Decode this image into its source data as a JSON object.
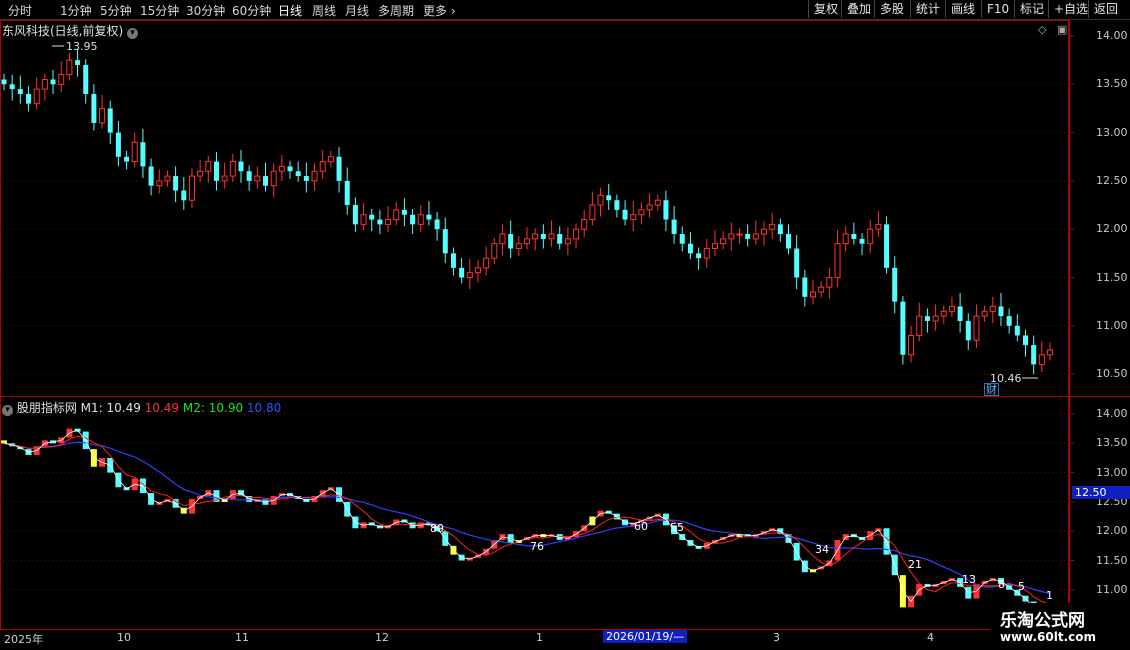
{
  "toolbar": {
    "tabs": [
      "分时",
      "1分钟",
      "5分钟",
      "15分钟",
      "30分钟",
      "60分钟",
      "日线",
      "周线",
      "月线",
      "多周期",
      "更多"
    ],
    "active_tab": "日线",
    "right_buttons": [
      "复权",
      "叠加",
      "多股",
      "统计",
      "画线",
      "F10",
      "标记",
      "+自选",
      "返回"
    ]
  },
  "main_panel": {
    "title": "东风科技(日线,前复权)",
    "high_label": "13.95",
    "low_label": "10.46",
    "finance_badge": "财",
    "price_ticks": [
      "14.00",
      "13.50",
      "13.00",
      "12.50",
      "12.00",
      "11.50",
      "11.00",
      "10.50"
    ]
  },
  "indicator_panel": {
    "name": "股朋指标网",
    "m1_label": "M1: 10.49",
    "m1_extra": "10.49",
    "m2_label": "M2: 10.90",
    "m2_extra": "10.80",
    "price_ticks": [
      "14.00",
      "13.50",
      "13.00",
      "12.50",
      "12.00",
      "11.50",
      "11.00"
    ],
    "current_tag": "12.50",
    "numbers": [
      "89",
      "76",
      "60",
      "55",
      "34",
      "21",
      "13",
      "8",
      "5",
      "1"
    ]
  },
  "date_axis": {
    "labels": [
      "2025年",
      "10",
      "11",
      "12",
      "1",
      "3",
      "4"
    ],
    "cursor_date": "2026/01/19/—"
  },
  "watermark": {
    "line1": "乐淘公式网",
    "line2": "www.60lt.com"
  },
  "colors": {
    "up": "#ff3232",
    "down": "#54ffff",
    "grid": "#7a0000",
    "border": "#b00000"
  },
  "chart_data": {
    "type": "candlestick",
    "ylim": [
      10.3,
      14.15
    ],
    "close_prices": [
      13.5,
      13.45,
      13.4,
      13.3,
      13.45,
      13.55,
      13.5,
      13.6,
      13.75,
      13.7,
      13.4,
      13.1,
      13.25,
      13.0,
      12.75,
      12.7,
      12.9,
      12.65,
      12.45,
      12.5,
      12.55,
      12.4,
      12.3,
      12.55,
      12.6,
      12.7,
      12.5,
      12.55,
      12.7,
      12.6,
      12.5,
      12.55,
      12.45,
      12.6,
      12.65,
      12.6,
      12.55,
      12.5,
      12.6,
      12.7,
      12.75,
      12.5,
      12.25,
      12.05,
      12.15,
      12.1,
      12.05,
      12.1,
      12.2,
      12.15,
      12.05,
      12.15,
      12.1,
      12.0,
      11.75,
      11.6,
      11.5,
      11.55,
      11.6,
      11.7,
      11.85,
      11.95,
      11.8,
      11.85,
      11.9,
      11.95,
      11.9,
      11.95,
      11.85,
      11.9,
      12.0,
      12.1,
      12.25,
      12.35,
      12.3,
      12.2,
      12.1,
      12.15,
      12.2,
      12.25,
      12.3,
      12.1,
      11.95,
      11.85,
      11.75,
      11.7,
      11.8,
      11.85,
      11.9,
      11.95,
      11.95,
      11.9,
      11.95,
      12.0,
      12.05,
      11.95,
      11.8,
      11.5,
      11.3,
      11.35,
      11.4,
      11.5,
      11.85,
      11.95,
      11.9,
      11.85,
      12.0,
      12.05,
      11.6,
      11.25,
      10.7,
      10.9,
      11.1,
      11.05,
      11.1,
      11.15,
      11.2,
      11.05,
      10.85,
      11.1,
      11.15,
      11.2,
      11.1,
      11.0,
      10.9,
      10.8,
      10.6,
      10.7,
      10.75
    ]
  }
}
